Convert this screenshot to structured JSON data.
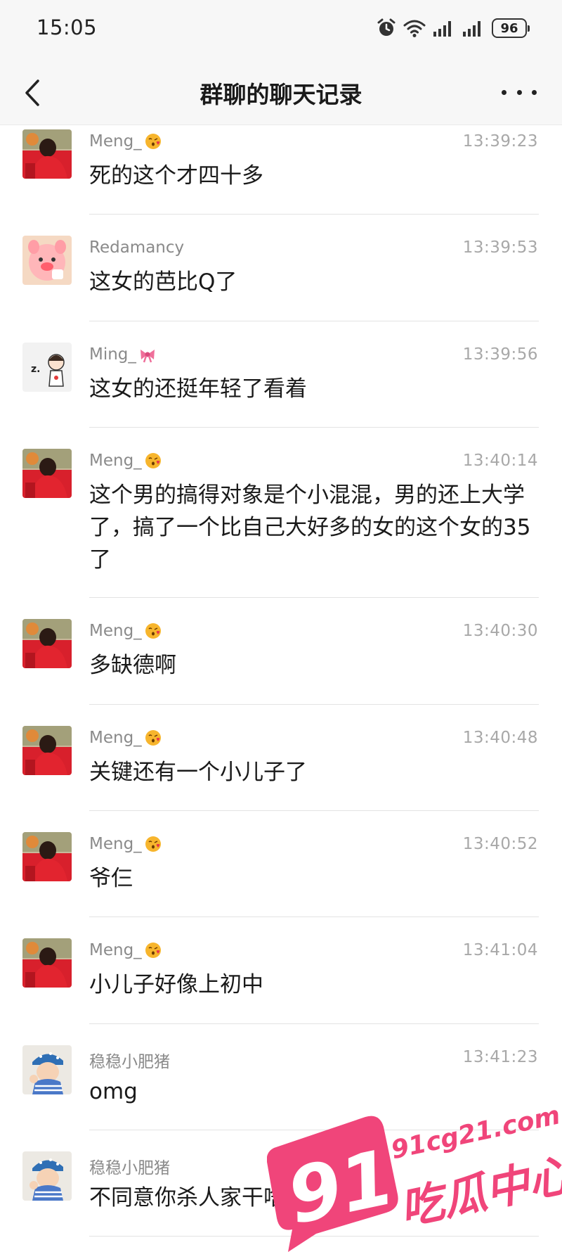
{
  "status_bar": {
    "time": "15:05",
    "icons": [
      "alarm-icon",
      "wifi-icon",
      "signal-icon",
      "signal-icon"
    ],
    "battery": "96"
  },
  "header": {
    "title": "群聊的聊天记录",
    "back_icon": "chevron-left-icon",
    "more_icon": "more-icon"
  },
  "messages": [
    {
      "sender": "Meng_",
      "sender_emoji": "kiss-face-icon",
      "time": "13:39:23",
      "text": "死的这个才四十多",
      "avatar": "red-hoodie-child"
    },
    {
      "sender": "Redamancy",
      "sender_emoji": "",
      "time": "13:39:53",
      "text": "这女的芭比Q了",
      "avatar": "pink-pig"
    },
    {
      "sender": "Ming_",
      "sender_emoji": "ribbon-icon",
      "time": "13:39:56",
      "text": "这女的还挺年轻了看着",
      "avatar": "sleepy-cartoon"
    },
    {
      "sender": "Meng_",
      "sender_emoji": "kiss-face-icon",
      "time": "13:40:14",
      "text": "这个男的搞得对象是个小混混，男的还上大学了，搞了一个比自己大好多的女的这个女的35了",
      "avatar": "red-hoodie-child"
    },
    {
      "sender": "Meng_",
      "sender_emoji": "kiss-face-icon",
      "time": "13:40:30",
      "text": "多缺德啊",
      "avatar": "red-hoodie-child"
    },
    {
      "sender": "Meng_",
      "sender_emoji": "kiss-face-icon",
      "time": "13:40:48",
      "text": "关键还有一个小儿子了",
      "avatar": "red-hoodie-child"
    },
    {
      "sender": "Meng_",
      "sender_emoji": "kiss-face-icon",
      "time": "13:40:52",
      "text": "爷仨",
      "avatar": "red-hoodie-child"
    },
    {
      "sender": "Meng_",
      "sender_emoji": "kiss-face-icon",
      "time": "13:41:04",
      "text": "小儿子好像上初中",
      "avatar": "red-hoodie-child"
    },
    {
      "sender": "稳稳小肥猪",
      "sender_emoji": "",
      "time": "13:41:23",
      "text": "omg",
      "avatar": "child-in-hat"
    },
    {
      "sender": "稳稳小肥猪",
      "sender_emoji": "",
      "time": "",
      "text": "不同意你杀人家干啥",
      "avatar": "child-in-hat"
    }
  ],
  "watermark": {
    "number": "91",
    "site": "91cg21.com",
    "brand": "吃瓜中心",
    "color": "#f0457a"
  }
}
